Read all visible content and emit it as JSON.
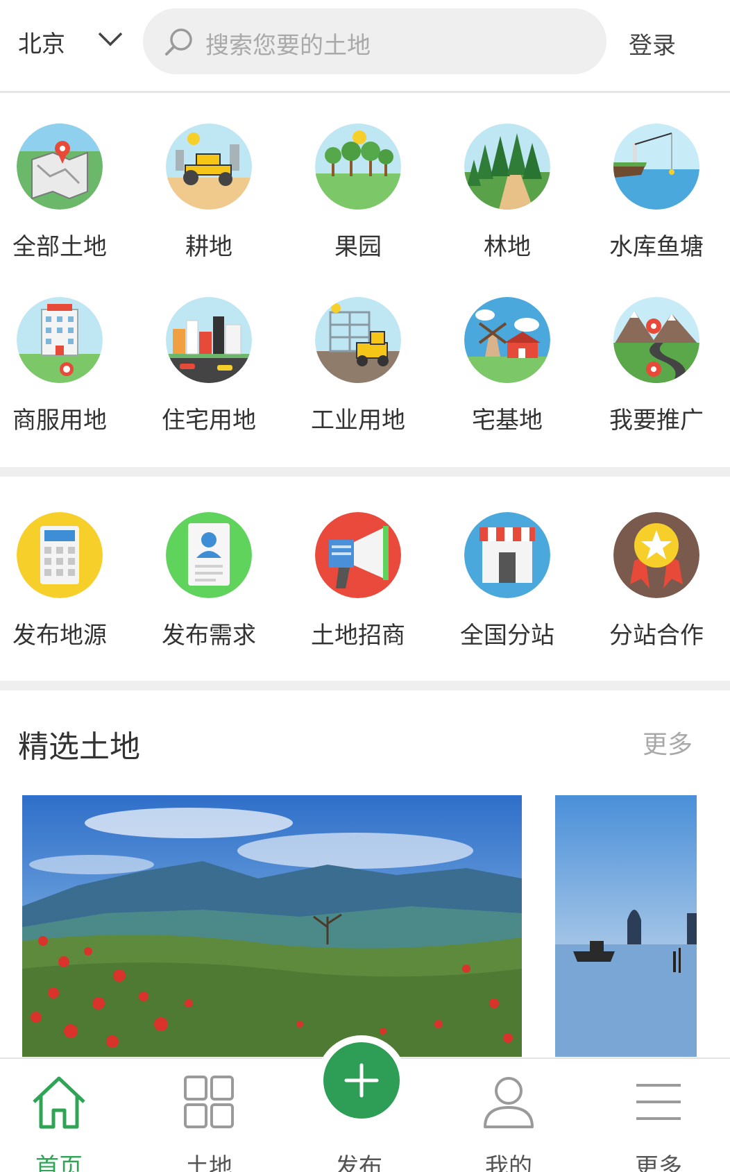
{
  "header": {
    "city": "北京",
    "search_placeholder": "搜索您要的土地",
    "login": "登录"
  },
  "categories_row1": [
    {
      "label": "全部土地",
      "icon": "map-pin-icon"
    },
    {
      "label": "耕地",
      "icon": "roller-icon"
    },
    {
      "label": "果园",
      "icon": "orchard-icon"
    },
    {
      "label": "林地",
      "icon": "forest-icon"
    },
    {
      "label": "水库鱼塘",
      "icon": "fishing-pond-icon"
    }
  ],
  "categories_row2": [
    {
      "label": "商服用地",
      "icon": "hotel-icon"
    },
    {
      "label": "住宅用地",
      "icon": "city-icon"
    },
    {
      "label": "工业用地",
      "icon": "industry-icon"
    },
    {
      "label": "宅基地",
      "icon": "windmill-farm-icon"
    },
    {
      "label": "我要推广",
      "icon": "mountain-road-icon"
    }
  ],
  "services": [
    {
      "label": "发布地源",
      "icon": "calculator-icon"
    },
    {
      "label": "发布需求",
      "icon": "contact-card-icon"
    },
    {
      "label": "土地招商",
      "icon": "megaphone-icon"
    },
    {
      "label": "全国分站",
      "icon": "storefront-icon"
    },
    {
      "label": "分站合作",
      "icon": "medal-icon"
    }
  ],
  "featured": {
    "title": "精选土地",
    "more": "更多"
  },
  "bottom_nav": [
    {
      "label": "首页",
      "icon": "home-icon",
      "active": true
    },
    {
      "label": "土地",
      "icon": "grid-icon",
      "active": false
    },
    {
      "label": "发布",
      "icon": "plus-icon",
      "active": false
    },
    {
      "label": "我的",
      "icon": "user-icon",
      "active": false
    },
    {
      "label": "更多",
      "icon": "menu-icon",
      "active": false
    }
  ],
  "colors": {
    "accent_green": "#2e9e57",
    "active_label": "#2fa455",
    "separator": "#efefef"
  }
}
